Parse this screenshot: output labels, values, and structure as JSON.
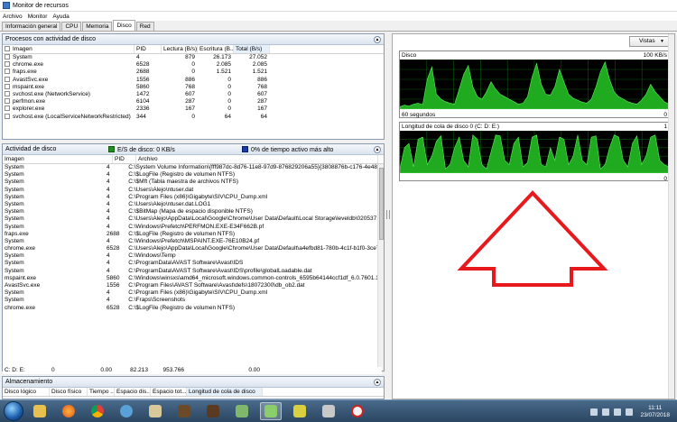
{
  "window": {
    "title": "Monitor de recursos"
  },
  "menu": [
    "Archivo",
    "Monitor",
    "Ayuda"
  ],
  "tabs": [
    {
      "label": "Información general",
      "active": false
    },
    {
      "label": "CPU",
      "active": false
    },
    {
      "label": "Memoria",
      "active": false
    },
    {
      "label": "Disco",
      "active": true
    },
    {
      "label": "Red",
      "active": false
    }
  ],
  "processes": {
    "title": "Procesos con actividad de disco",
    "columns": [
      "Imagen",
      "PID",
      "Lectura (B/s)",
      "Escritura (B...",
      "Total (B/s)"
    ],
    "rows": [
      [
        "System",
        "4",
        "879",
        "26.173",
        "27.052"
      ],
      [
        "chrome.exe",
        "6528",
        "0",
        "2.085",
        "2.085"
      ],
      [
        "fraps.exe",
        "2688",
        "0",
        "1.521",
        "1.521"
      ],
      [
        "AvastSvc.exe",
        "1556",
        "886",
        "0",
        "886"
      ],
      [
        "mspaint.exe",
        "5860",
        "768",
        "0",
        "768"
      ],
      [
        "svchost.exe (NetworkService)",
        "1472",
        "607",
        "0",
        "607"
      ],
      [
        "perfmon.exe",
        "6104",
        "287",
        "0",
        "287"
      ],
      [
        "explorer.exe",
        "2336",
        "167",
        "0",
        "167"
      ],
      [
        "svchost.exe (LocalServiceNetworkRestricted)",
        "344",
        "0",
        "64",
        "64"
      ]
    ]
  },
  "activity": {
    "title": "Actividad de disco",
    "io_legend": "E/S de disco: 0 KB/s",
    "active_legend": "0% de tiempo activo más alto",
    "columns": [
      "Imagen",
      "PID",
      "Archivo"
    ],
    "rows": [
      [
        "System",
        "4",
        "C:\\System Volume Information\\{fff987dc-8d76-11e8-97d9-876829206a55}{3808876b-c176-4e48-b7ae"
      ],
      [
        "System",
        "4",
        "C:\\$LogFile (Registro de volumen NTFS)"
      ],
      [
        "System",
        "4",
        "C:\\$Mft (Tabla maestra de archivos NTFS)"
      ],
      [
        "System",
        "4",
        "C:\\Users\\Alejo\\ntuser.dat"
      ],
      [
        "System",
        "4",
        "C:\\Program Files (x86)\\Gigabyte\\SIV\\CPU_Dump.xml"
      ],
      [
        "System",
        "4",
        "C:\\Users\\Alejo\\ntuser.dat.LOG1"
      ],
      [
        "System",
        "4",
        "C:\\$BitMap (Mapa de espacio disponible NTFS)"
      ],
      [
        "System",
        "4",
        "C:\\Users\\Alejo\\AppData\\Local\\Google\\Chrome\\User Data\\Default\\Local Storage\\leveldb\\020537.log"
      ],
      [
        "System",
        "4",
        "C:\\Windows\\Prefetch\\PERFMON.EXE-E34F662B.pf"
      ],
      [
        "fraps.exe",
        "2688",
        "C:\\$LogFile (Registro de volumen NTFS)"
      ],
      [
        "System",
        "4",
        "C:\\Windows\\Prefetch\\MSPAINT.EXE-76E10B24.pf"
      ],
      [
        "chrome.exe",
        "6528",
        "C:\\Users\\Alejo\\AppData\\Local\\Google\\Chrome\\User Data\\Default\\a4efbd81-780b-4c1f-b1f0-3ce7e8"
      ],
      [
        "System",
        "4",
        "C:\\Windows\\Temp"
      ],
      [
        "System",
        "4",
        "C:\\ProgramData\\AVAST Software\\Avast\\IDS"
      ],
      [
        "System",
        "4",
        "C:\\ProgramData\\AVAST Software\\Avast\\IDS\\profile\\globalLoadable.dat"
      ],
      [
        "mspaint.exe",
        "5860",
        "C:\\Windows\\winsxs\\amd64_microsoft.windows.common-controls_6595b64144ccf1df_6.0.7601.1883"
      ],
      [
        "AvastSvc.exe",
        "1556",
        "C:\\Program Files\\AVAST Software\\Avast\\defs\\18072300\\db_ob2.dat"
      ],
      [
        "System",
        "4",
        "C:\\Program Files (x86)\\Gigabyte\\SIV\\CPU_Dump.xml"
      ],
      [
        "System",
        "4",
        "C:\\Fraps\\Screenshots"
      ],
      [
        "chrome.exe",
        "6528",
        "C:\\$LogFile (Registro de volumen NTFS)"
      ]
    ]
  },
  "storage": {
    "title": "Almacenamiento",
    "columns": [
      "Disco lógico",
      "Disco físico",
      "Tiempo ...",
      "Espacio dis...",
      "Espacio tot...",
      "Longitud de cola de disco"
    ],
    "rows": [
      [
        "C: D: E:",
        "0",
        "0.00",
        "82.213",
        "953.766",
        "0.00"
      ]
    ]
  },
  "views_button": "Vistas",
  "graph_disk": {
    "title": "Disco",
    "max_label": "100 KB/s",
    "time_label": "60 segundos",
    "min_label": "0",
    "values": [
      5,
      8,
      6,
      10,
      12,
      9,
      60,
      85,
      30,
      20,
      15,
      12,
      10,
      40,
      70,
      88,
      45,
      25,
      20,
      35,
      55,
      40,
      30,
      25,
      20,
      15,
      10,
      12,
      25,
      65,
      92,
      50,
      30,
      28,
      45,
      80,
      55,
      30,
      22,
      18,
      14,
      12,
      20,
      45,
      75,
      95,
      60,
      35,
      25,
      20,
      15,
      12,
      10,
      18,
      30,
      50,
      35,
      25,
      15,
      10
    ]
  },
  "graph_queue": {
    "title": "Longitud de cola de disco 0 (C: D: E:)",
    "max_label": "1",
    "min_label": "0",
    "values": [
      10,
      60,
      70,
      15,
      80,
      85,
      20,
      40,
      75,
      88,
      10,
      20,
      60,
      85,
      30,
      15,
      90,
      80,
      20,
      10,
      50,
      90,
      88,
      30,
      20,
      70,
      85,
      15,
      25,
      85,
      90,
      20,
      15,
      60,
      30,
      85,
      80,
      20,
      40,
      90,
      30,
      20,
      85,
      88,
      10,
      20,
      60,
      90,
      85,
      30,
      15,
      70,
      88,
      20,
      40,
      85,
      90,
      30,
      20,
      15
    ]
  },
  "taskbar": {
    "time": "11:11",
    "date": "23/07/2018",
    "apps": [
      "explorer",
      "firefox",
      "chrome",
      "perfmon",
      "folder",
      "minecraft",
      "minecraft2",
      "paint",
      "resmon",
      "fraps",
      "mail",
      "opera"
    ]
  },
  "colors": {
    "graph_fill": "#1faa1f",
    "graph_bg": "#000000",
    "arrow": "#e8191c"
  }
}
